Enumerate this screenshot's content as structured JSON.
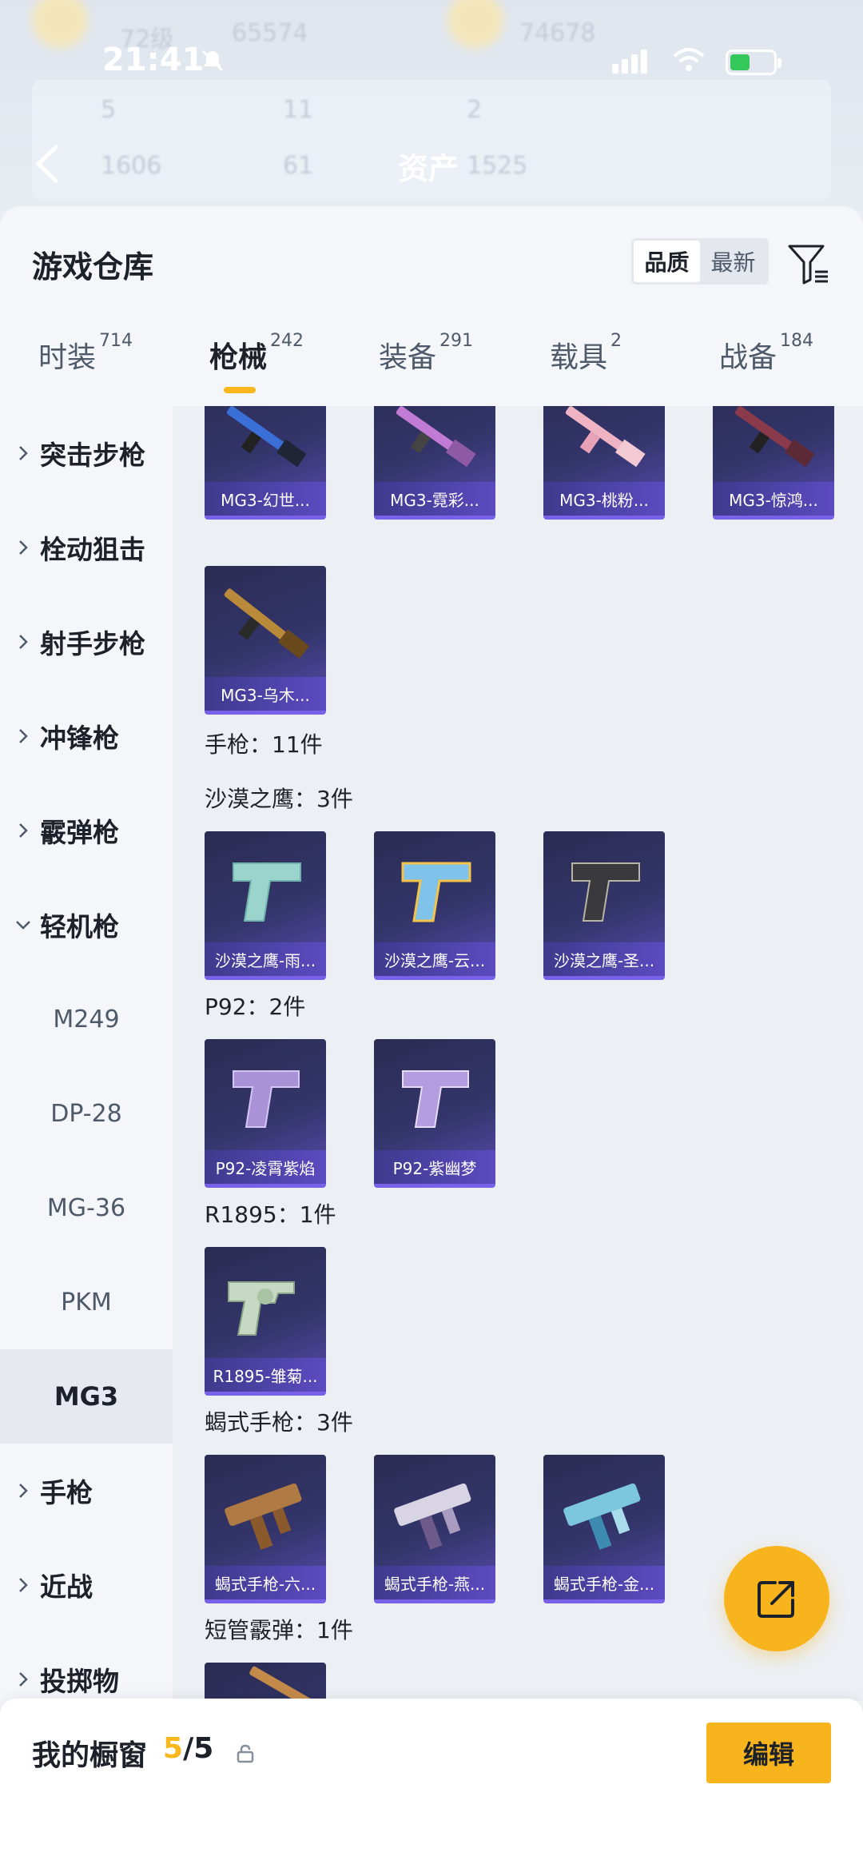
{
  "status_bar": {
    "time": "21:41"
  },
  "header": {
    "title": "资产",
    "ghost_values": [
      "72级",
      "65574",
      "74678",
      "5",
      "11",
      "2",
      "1606",
      "61",
      "1525"
    ]
  },
  "warehouse": {
    "title": "游戏仓库",
    "sort": {
      "options": [
        "品质",
        "最新"
      ],
      "active": "品质"
    },
    "tabs": [
      {
        "label": "时装",
        "count": "714"
      },
      {
        "label": "枪械",
        "count": "242",
        "active": true
      },
      {
        "label": "装备",
        "count": "291"
      },
      {
        "label": "载具",
        "count": "2"
      },
      {
        "label": "战备",
        "count": "184"
      }
    ]
  },
  "sidebar": {
    "categories": [
      "突击步枪",
      "栓动狙击",
      "射手步枪",
      "冲锋枪",
      "霰弹枪",
      "轻机枪"
    ],
    "subcategories": [
      "M249",
      "DP-28",
      "MG-36",
      "PKM",
      "MG3"
    ],
    "active_sub": "MG3",
    "categories_after": [
      "手枪",
      "近战",
      "投掷物"
    ]
  },
  "items": {
    "mg3_row": [
      "MG3-幻世...",
      "MG3-霓彩...",
      "MG3-桃粉...",
      "MG3-惊鸿..."
    ],
    "mg3_extra": [
      "MG3-乌木..."
    ],
    "pistol_header": "手枪：11件",
    "deagle_header": "沙漠之鹰：3件",
    "deagle": [
      "沙漠之鹰-雨...",
      "沙漠之鹰-云...",
      "沙漠之鹰-圣..."
    ],
    "p92_header": "P92：2件",
    "p92": [
      "P92-凌霄紫焰",
      "P92-紫幽梦"
    ],
    "r1895_header": "R1895：1件",
    "r1895": [
      "R1895-雏菊..."
    ],
    "scorpion_header": "蝎式手枪：3件",
    "scorpion": [
      "蝎式手枪-六...",
      "蝎式手枪-燕...",
      "蝎式手枪-金..."
    ],
    "shotgun_header": "短管霰弹：1件"
  },
  "showcase": {
    "title": "我的橱窗",
    "current": "5",
    "sep_total": "/5",
    "edit_label": "编辑"
  },
  "colors": {
    "accent": "#f8b41c",
    "card_border": "#7a61ea",
    "card_bg": "#2b2c52"
  }
}
